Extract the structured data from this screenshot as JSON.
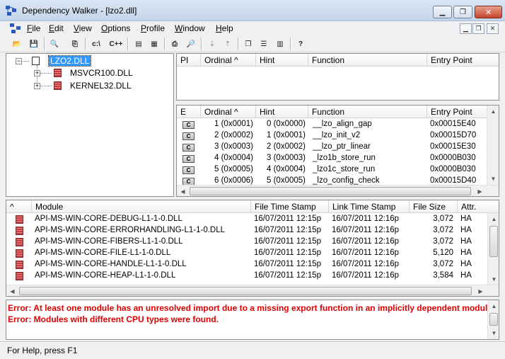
{
  "window": {
    "title": "Dependency Walker - [lzo2.dll]"
  },
  "menu": [
    {
      "label": "File",
      "accel": "F"
    },
    {
      "label": "Edit",
      "accel": "E"
    },
    {
      "label": "View",
      "accel": "V"
    },
    {
      "label": "Options",
      "accel": "O"
    },
    {
      "label": "Profile",
      "accel": "P"
    },
    {
      "label": "Window",
      "accel": "W"
    },
    {
      "label": "Help",
      "accel": "H"
    }
  ],
  "toolbar": {
    "buttons": [
      {
        "name": "open-icon",
        "glyph": "📂"
      },
      {
        "name": "save-icon",
        "glyph": "💾"
      },
      {
        "name": "find-icon",
        "glyph": "🔍"
      },
      {
        "name": "copy-icon",
        "glyph": "⎘"
      },
      {
        "name": "full-paths-icon",
        "glyph": "c:\\"
      },
      {
        "name": "undecorate-icon",
        "glyph": "C++"
      },
      {
        "name": "properties-icon",
        "glyph": "▤"
      },
      {
        "name": "system-info-icon",
        "glyph": "▦"
      },
      {
        "name": "print-icon",
        "glyph": "⎙"
      },
      {
        "name": "view-icon",
        "glyph": "🔎"
      },
      {
        "name": "expand-icon",
        "glyph": "⇣"
      },
      {
        "name": "collapse-icon",
        "glyph": "⇡"
      },
      {
        "name": "cascade-icon",
        "glyph": "❐"
      },
      {
        "name": "tile-horizontal-icon",
        "glyph": "☰"
      },
      {
        "name": "tile-vertical-icon",
        "glyph": "▥"
      },
      {
        "name": "help-icon",
        "glyph": "?"
      }
    ]
  },
  "tree": {
    "root": "LZO2.DLL",
    "children": [
      "MSVCR100.DLL",
      "KERNEL32.DLL"
    ]
  },
  "imports": {
    "columns": [
      "PI",
      "Ordinal ^",
      "Hint",
      "Function",
      "Entry Point"
    ]
  },
  "exports": {
    "columns": [
      "E",
      "Ordinal ^",
      "Hint",
      "Function",
      "Entry Point"
    ],
    "rows": [
      {
        "badge": "C",
        "ordinal": "1 (0x0001)",
        "hint": "0 (0x0000)",
        "function": "__lzo_align_gap",
        "entry": "0x00015E40"
      },
      {
        "badge": "C",
        "ordinal": "2 (0x0002)",
        "hint": "1 (0x0001)",
        "function": "__lzo_init_v2",
        "entry": "0x00015D70"
      },
      {
        "badge": "C",
        "ordinal": "3 (0x0003)",
        "hint": "2 (0x0002)",
        "function": "__lzo_ptr_linear",
        "entry": "0x00015E30"
      },
      {
        "badge": "C",
        "ordinal": "4 (0x0004)",
        "hint": "3 (0x0003)",
        "function": "_lzo1b_store_run",
        "entry": "0x0000B030"
      },
      {
        "badge": "C",
        "ordinal": "5 (0x0005)",
        "hint": "4 (0x0004)",
        "function": "_lzo1c_store_run",
        "entry": "0x0000B030"
      },
      {
        "badge": "C",
        "ordinal": "6 (0x0006)",
        "hint": "5 (0x0005)",
        "function": "_lzo_config_check",
        "entry": "0x00015D40"
      }
    ]
  },
  "modules": {
    "columns": [
      "^",
      "Module",
      "File Time Stamp",
      "Link Time Stamp",
      "File Size",
      "Attr."
    ],
    "rows": [
      {
        "module": "API-MS-WIN-CORE-DEBUG-L1-1-0.DLL",
        "file_ts": "16/07/2011 12:15p",
        "link_ts": "16/07/2011 12:16p",
        "size": "3,072",
        "attr": "HA"
      },
      {
        "module": "API-MS-WIN-CORE-ERRORHANDLING-L1-1-0.DLL",
        "file_ts": "16/07/2011 12:15p",
        "link_ts": "16/07/2011 12:16p",
        "size": "3,072",
        "attr": "HA"
      },
      {
        "module": "API-MS-WIN-CORE-FIBERS-L1-1-0.DLL",
        "file_ts": "16/07/2011 12:15p",
        "link_ts": "16/07/2011 12:16p",
        "size": "3,072",
        "attr": "HA"
      },
      {
        "module": "API-MS-WIN-CORE-FILE-L1-1-0.DLL",
        "file_ts": "16/07/2011 12:15p",
        "link_ts": "16/07/2011 12:16p",
        "size": "5,120",
        "attr": "HA"
      },
      {
        "module": "API-MS-WIN-CORE-HANDLE-L1-1-0.DLL",
        "file_ts": "16/07/2011 12:15p",
        "link_ts": "16/07/2011 12:16p",
        "size": "3,072",
        "attr": "HA"
      },
      {
        "module": "API-MS-WIN-CORE-HEAP-L1-1-0.DLL",
        "file_ts": "16/07/2011 12:15p",
        "link_ts": "16/07/2011 12:16p",
        "size": "3,584",
        "attr": "HA"
      }
    ]
  },
  "log": [
    "Error: At least one module has an unresolved import due to a missing export function in an implicitly dependent module.",
    "Error: Modules with different CPU types were found."
  ],
  "status": "For Help, press F1",
  "colors": {
    "error": "#e00000",
    "selection": "#3399ff"
  }
}
